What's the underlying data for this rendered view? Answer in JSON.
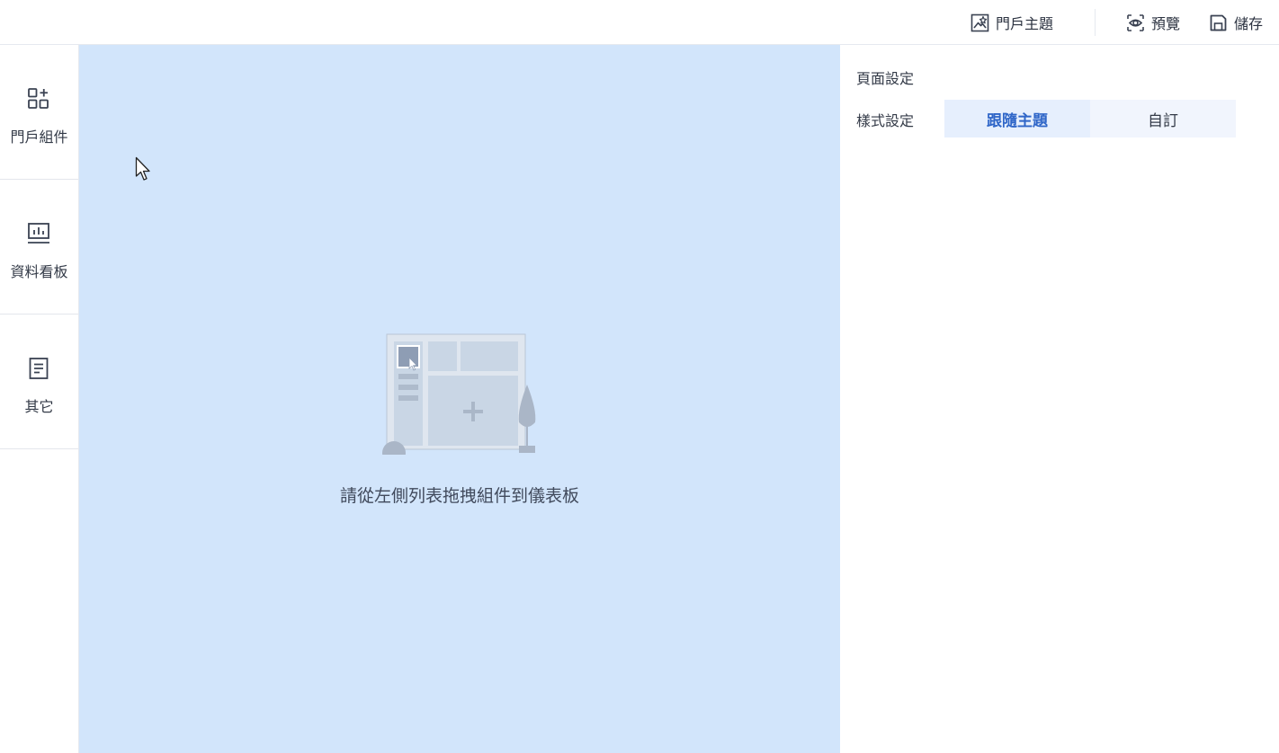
{
  "toolbar": {
    "theme_label": "門戶主題",
    "preview_label": "預覽",
    "save_label": "儲存"
  },
  "sidebar": {
    "items": [
      {
        "label": "門戶組件",
        "icon": "widgets-icon"
      },
      {
        "label": "資料看板",
        "icon": "dashboard-chart-icon"
      },
      {
        "label": "其它",
        "icon": "document-icon"
      }
    ]
  },
  "canvas": {
    "empty_message": "請從左側列表拖拽組件到儀表板",
    "background_color": "#d2e5fb"
  },
  "panel": {
    "page_settings_label": "頁面設定",
    "style_settings_label": "樣式設定",
    "style_options": [
      "跟隨主題",
      "自訂"
    ],
    "selected_style": "跟隨主題",
    "accent_color": "#2f66c8"
  }
}
